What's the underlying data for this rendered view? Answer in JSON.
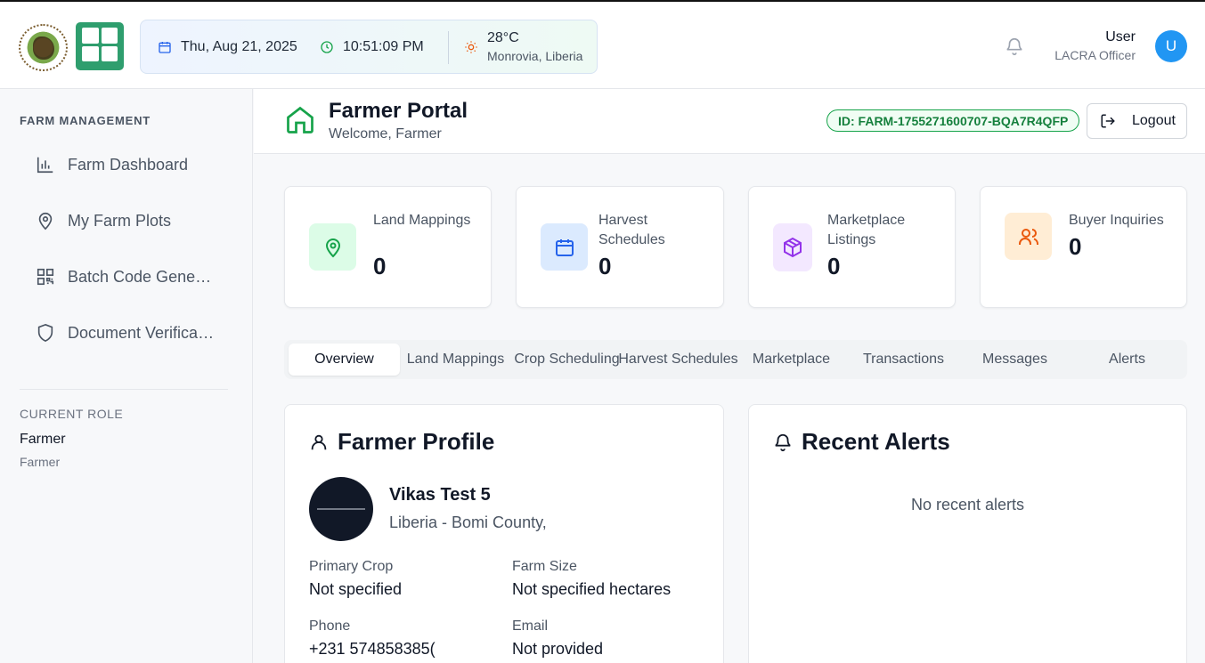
{
  "header": {
    "date": "Thu, Aug 21, 2025",
    "time": "10:51:09 PM",
    "temperature": "28°C",
    "location": "Monrovia, Liberia",
    "user_name": "User",
    "user_role": "LACRA Officer",
    "avatar_initial": "U"
  },
  "sidebar": {
    "section_title": "FARM MANAGEMENT",
    "items": [
      {
        "label": "Farm Dashboard",
        "icon": "bar-chart-icon"
      },
      {
        "label": "My Farm Plots",
        "icon": "map-pin-icon"
      },
      {
        "label": "Batch Code Generator",
        "icon": "qr-code-icon"
      },
      {
        "label": "Document Verification",
        "icon": "shield-icon"
      }
    ],
    "role_heading": "CURRENT ROLE",
    "role_value": "Farmer",
    "role_sub": "Farmer"
  },
  "main": {
    "title": "Farmer Portal",
    "subtitle": "Welcome, Farmer",
    "farm_id": "ID: FARM-1755271600707-BQA7R4QFP",
    "logout_label": "Logout",
    "stats": [
      {
        "label": "Land Mappings",
        "value": "0",
        "icon": "map-pin-icon",
        "color": "#16a34a",
        "bg": "#dcfce7"
      },
      {
        "label": "Harvest Schedules",
        "value": "0",
        "icon": "calendar-icon",
        "color": "#2563eb",
        "bg": "#dbeafe"
      },
      {
        "label": "Marketplace Listings",
        "value": "0",
        "icon": "package-icon",
        "color": "#9333ea",
        "bg": "#f3e8ff"
      },
      {
        "label": "Buyer Inquiries",
        "value": "0",
        "icon": "users-icon",
        "color": "#ea580c",
        "bg": "#ffedd5"
      }
    ],
    "tabs": [
      "Overview",
      "Land Mappings",
      "Crop Scheduling",
      "Harvest Schedules",
      "Marketplace",
      "Transactions",
      "Messages",
      "Alerts"
    ],
    "active_tab": "Overview",
    "profile": {
      "title": "Farmer Profile",
      "name": "Vikas Test 5",
      "location": "Liberia - Bomi County,",
      "primary_crop_label": "Primary Crop",
      "primary_crop": "Not specified",
      "farm_size_label": "Farm Size",
      "farm_size": "Not specified hectares",
      "phone_label": "Phone",
      "phone": "+231 574858385(",
      "email_label": "Email",
      "email": "Not provided"
    },
    "alerts": {
      "title": "Recent Alerts",
      "empty_text": "No recent alerts"
    }
  }
}
